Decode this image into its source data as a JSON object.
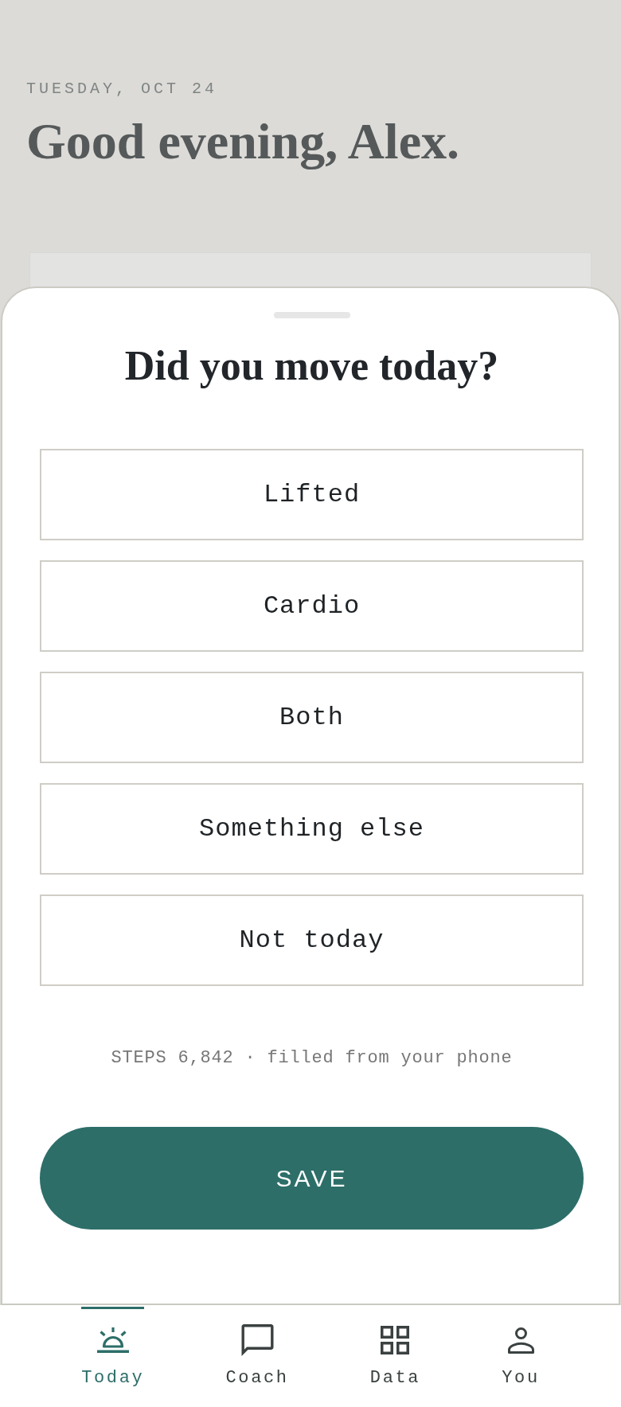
{
  "background": {
    "date": "TUESDAY, OCT 24",
    "greeting": "Good evening, Alex."
  },
  "sheet": {
    "title": "Did you move today?",
    "options": [
      {
        "label": "Lifted",
        "selected": false
      },
      {
        "label": "Cardio",
        "selected": false
      },
      {
        "label": "Both",
        "selected": false
      },
      {
        "label": "Something else",
        "selected": false
      },
      {
        "label": "Not today",
        "selected": false
      }
    ],
    "note": "STEPS 6,842 · filled from your phone",
    "save_button": "SAVE"
  },
  "nav": {
    "tabs": [
      {
        "label": "Today",
        "selected": true
      },
      {
        "label": "Coach",
        "selected": false
      },
      {
        "label": "Data",
        "selected": false
      },
      {
        "label": "You",
        "selected": false
      }
    ]
  }
}
